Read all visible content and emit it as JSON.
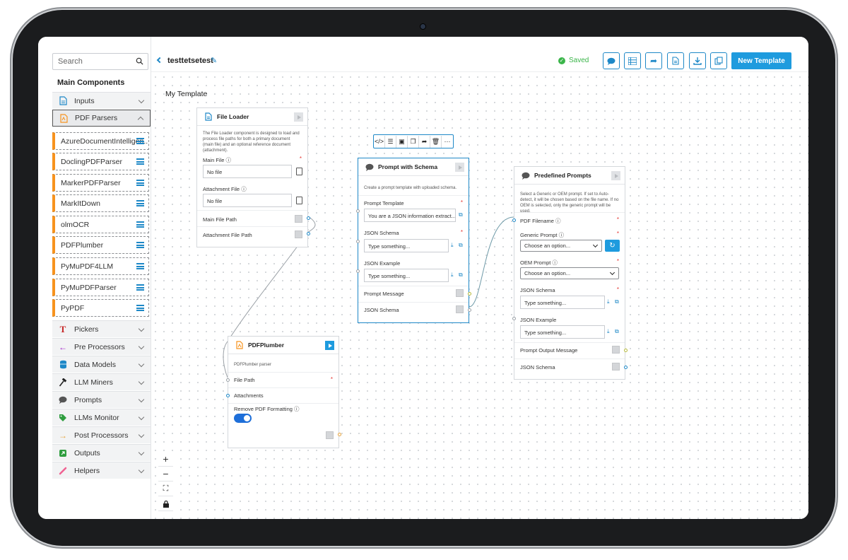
{
  "sidebar": {
    "search_placeholder": "Search",
    "main_title": "Main Components",
    "categories": [
      {
        "label": "Inputs",
        "icon": "document-icon"
      },
      {
        "label": "PDF Parsers",
        "icon": "pdf-icon"
      },
      {
        "label": "Pickers",
        "icon": "t-icon"
      },
      {
        "label": "Pre Processors",
        "icon": "arrow-left-icon"
      },
      {
        "label": "Data Models",
        "icon": "database-icon"
      },
      {
        "label": "LLM Miners",
        "icon": "hammer-icon"
      },
      {
        "label": "Prompts",
        "icon": "chat-icon"
      },
      {
        "label": "LLMs Monitor",
        "icon": "tag-icon"
      },
      {
        "label": "Post Processors",
        "icon": "arrow-right-icon"
      },
      {
        "label": "Outputs",
        "icon": "output-icon"
      },
      {
        "label": "Helpers",
        "icon": "pencil-icon"
      }
    ],
    "pdf_parsers": [
      "AzureDocumentIntelligen...",
      "DoclingPDFParser",
      "MarkerPDFParser",
      "MarkItDown",
      "olmOCR",
      "PDFPlumber",
      "PyMuPDF4LLM",
      "PyMuPDFParser",
      "PyPDF"
    ]
  },
  "topbar": {
    "template_name": "testtetsetest",
    "saved_label": "Saved",
    "new_template_label": "New Template",
    "icons": [
      "chat-icon",
      "list-icon",
      "share-icon",
      "document-icon",
      "download-icon",
      "copy-icon"
    ]
  },
  "canvas": {
    "title": "My Template",
    "file_loader": {
      "title": "File Loader",
      "desc": "The File Loader component is designed to load and process file paths for both a primary document (main file) and an optional reference document (attachment).",
      "main_file_label": "Main File",
      "main_file_value": "No file",
      "attachment_label": "Attachment File",
      "attachment_value": "No file",
      "main_file_path": "Main File Path",
      "attachment_file_path": "Attachment File Path"
    },
    "pdfplumber": {
      "title": "PDFPlumber",
      "desc": "PDFPlumber parser",
      "file_path": "File Path",
      "attachments": "Attachments",
      "remove_formatting": "Remove PDF Formatting"
    },
    "prompt_schema": {
      "title": "Prompt with Schema",
      "desc": "Create a prompt template with uploaded schema.",
      "prompt_template_label": "Prompt Template",
      "prompt_template_value": "You are a JSON information extract...",
      "json_schema_label": "JSON Schema",
      "json_schema_placeholder": "Type something...",
      "json_example_label": "JSON Example",
      "json_example_placeholder": "Type something...",
      "prompt_message": "Prompt Message",
      "json_schema_out": "JSON Schema"
    },
    "predefined": {
      "title": "Predefined Prompts",
      "desc": "Select a Generic or OEM prompt. If set to Auto-detect, it will be chosen based on the file name. If no OEM is selected, only the generic prompt will be used.",
      "pdf_filename": "PDF Filename",
      "generic_prompt": "Generic Prompt",
      "generic_option": "Choose an option...",
      "oem_prompt": "OEM Prompt",
      "oem_option": "Choose an option...",
      "json_schema_label": "JSON Schema",
      "json_schema_placeholder": "Type something...",
      "json_example_label": "JSON Example",
      "json_example_placeholder": "Type something...",
      "prompt_output": "Prompt Output Message",
      "json_schema_out": "JSON Schema"
    },
    "toolbar_icons": [
      "code-icon",
      "sliders-icon",
      "save-icon",
      "copy-icon",
      "share-icon",
      "trash-icon",
      "more-icon"
    ],
    "zoom": {
      "plus": "+",
      "minus": "−"
    }
  },
  "colors": {
    "accent": "#1e9bde",
    "pdf_accent": "#f7931e",
    "saved": "#3bb54a",
    "required": "#e53935"
  }
}
